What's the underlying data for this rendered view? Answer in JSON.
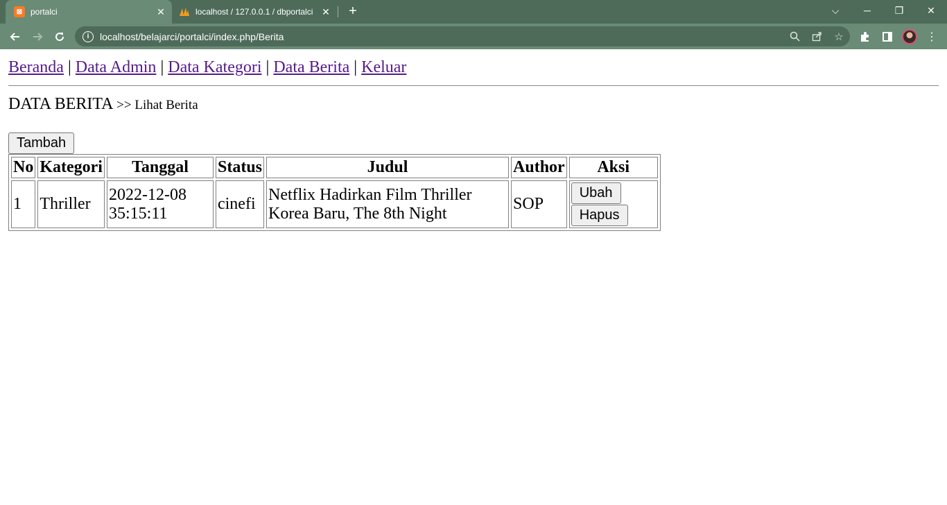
{
  "browser": {
    "tabs": [
      {
        "title": "portalci",
        "active": true
      },
      {
        "title": "localhost / 127.0.0.1 / dbportalci",
        "active": false
      }
    ],
    "address": "localhost/belajarci/portalci/index.php/Berita"
  },
  "nav": {
    "links": [
      "Beranda",
      "Data Admin",
      "Data Kategori",
      "Data Berita",
      "Keluar"
    ],
    "separator": "|"
  },
  "heading": {
    "title": "DATA BERITA",
    "subtitle": ">> Lihat Berita"
  },
  "add_button": "Tambah",
  "table": {
    "headers": [
      "No",
      "Kategori",
      "Tanggal",
      "Status",
      "Judul",
      "Author",
      "Aksi"
    ],
    "rows": [
      {
        "no": "1",
        "kategori": "Thriller",
        "tanggal_date": "2022-12-08",
        "tanggal_time": "35:15:11",
        "status": "cinefi",
        "judul_line1": "Netflix Hadirkan Film Thriller",
        "judul_line2": "Korea Baru, The 8th Night",
        "author": "SOP",
        "edit": "Ubah",
        "delete": "Hapus"
      }
    ]
  }
}
